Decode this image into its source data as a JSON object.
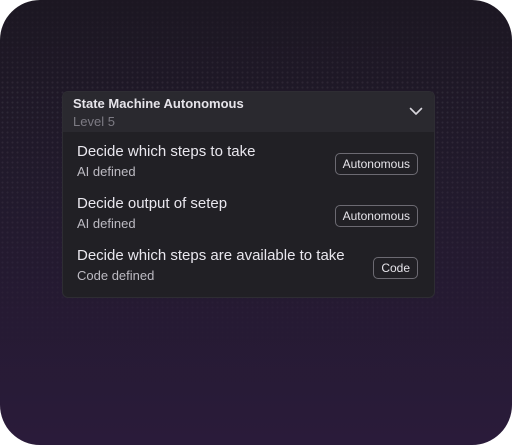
{
  "panel": {
    "title": "State Machine Autonomous",
    "subtitle": "Level 5",
    "expand_icon": "chevron-down-icon"
  },
  "rows": [
    {
      "title": "Decide which steps to take",
      "subtitle": "AI defined",
      "tag": "Autonomous"
    },
    {
      "title": "Decide output of setep",
      "subtitle": "AI defined",
      "tag": "Autonomous"
    },
    {
      "title": "Decide which steps are available to take",
      "subtitle": "Code defined",
      "tag": "Code"
    }
  ],
  "colors": {
    "background_top": "#1c1722",
    "background_bottom": "#2a1b3a",
    "panel": "#212025",
    "panel_header": "#2a292f"
  }
}
